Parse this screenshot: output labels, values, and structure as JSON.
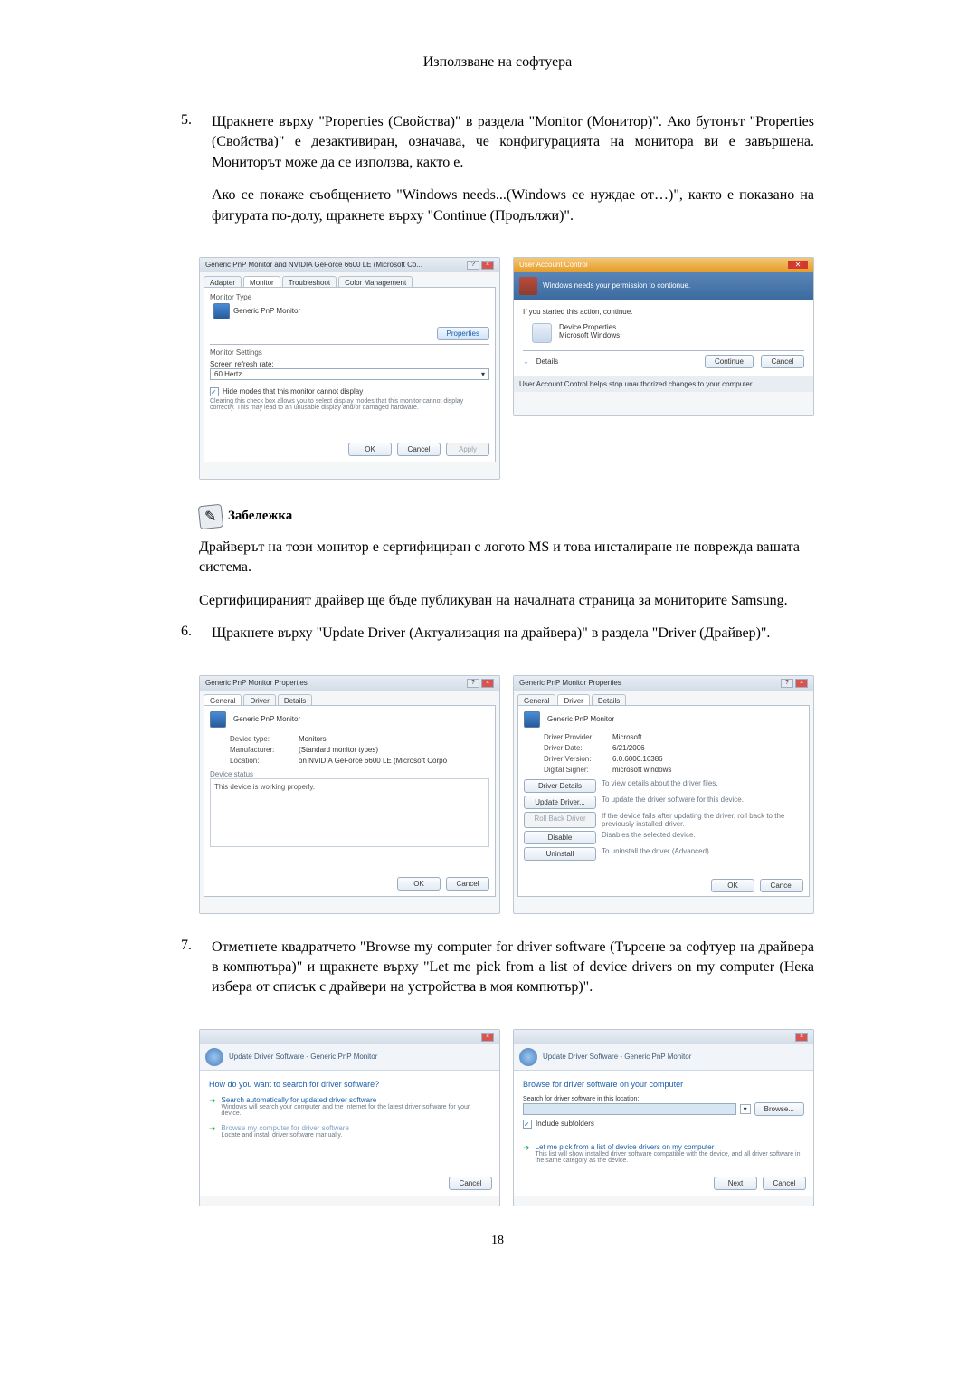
{
  "pageHeader": "Използване на софтуера",
  "step5": {
    "num": "5.",
    "para1": "Щракнете върху \"Properties (Свойства)\" в раздела \"Monitor (Монитор)\". Ако бутонът \"Properties (Свойства)\" е дезактивиран, означава, че конфигурацията на монитора ви е завършена. Мониторът може да се използва, както е.",
    "para2": "Ако се покаже съобщението \"Windows needs...(Windows се нуждае от…)\", както е показано на фигурата по-долу, щракнете върху \"Continue (Продължи)\"."
  },
  "fig1a": {
    "title": "Generic PnP Monitor and NVIDIA GeForce 6600 LE (Microsoft Co...",
    "tabs": {
      "adapter": "Adapter",
      "monitor": "Monitor",
      "troubleshoot": "Troubleshoot",
      "color": "Color Management"
    },
    "monitorType": "Monitor Type",
    "monitorName": "Generic PnP Monitor",
    "propertiesBtn": "Properties",
    "monitorSettings": "Monitor Settings",
    "refreshLabel": "Screen refresh rate:",
    "refreshVal": "60 Hertz",
    "hideModes": "Hide modes that this monitor cannot display",
    "hideHelp": "Clearing this check box allows you to select display modes that this monitor cannot display correctly. This may lead to an unusable display and/or damaged hardware.",
    "ok": "OK",
    "cancel": "Cancel",
    "apply": "Apply"
  },
  "fig1b": {
    "title": "User Account Control",
    "headline": "Windows needs your permission to contionue.",
    "ifStarted": "If you started this action, continue.",
    "devProps": "Device Properties",
    "msWindows": "Microsoft Windows",
    "details": "Details",
    "continue": "Continue",
    "cancel": "Cancel",
    "footer": "User Account Control helps stop unauthorized changes to your computer."
  },
  "noteTitle": "Забележка",
  "note1": "Драйверът на този монитор е сертифициран с логото MS и това инсталиране не поврежда вашата система.",
  "note2": "Сертифицираният драйвер ще бъде публикуван на началната страница за мониторите Samsung.",
  "step6": {
    "num": "6.",
    "text": "Щракнете върху \"Update Driver (Актуализация на драйвера)\" в раздела \"Driver (Драйвер)\"."
  },
  "fig2a": {
    "title": "Generic PnP Monitor Properties",
    "tabs": {
      "general": "General",
      "driver": "Driver",
      "details": "Details"
    },
    "name": "Generic PnP Monitor",
    "deviceType": "Device type:",
    "deviceTypeV": "Monitors",
    "manufacturer": "Manufacturer:",
    "manufacturerV": "(Standard monitor types)",
    "location": "Location:",
    "locationV": "on NVIDIA GeForce 6600 LE (Microsoft Corpo",
    "statusLabel": "Device status",
    "statusText": "This device is working properly.",
    "ok": "OK",
    "cancel": "Cancel"
  },
  "fig2b": {
    "title": "Generic PnP Monitor Properties",
    "tabs": {
      "general": "General",
      "driver": "Driver",
      "details": "Details"
    },
    "name": "Generic PnP Monitor",
    "provider": "Driver Provider:",
    "providerV": "Microsoft",
    "date": "Driver Date:",
    "dateV": "6/21/2006",
    "version": "Driver Version:",
    "versionV": "6.0.6000.16386",
    "signer": "Digital Signer:",
    "signerV": "microsoft windows",
    "driverDetails": "Driver Details",
    "driverDetailsD": "To view details about the driver files.",
    "updateDriver": "Update Driver...",
    "updateDriverD": "To update the driver software for this device.",
    "rollBack": "Roll Back Driver",
    "rollBackD": "If the device fails after updating the driver, roll back to the previously installed driver.",
    "disable": "Disable",
    "disableD": "Disables the selected device.",
    "uninstall": "Uninstall",
    "uninstallD": "To uninstall the driver (Advanced).",
    "ok": "OK",
    "cancel": "Cancel"
  },
  "step7": {
    "num": "7.",
    "text": "Отметнете квадратчето \"Browse my computer for driver software (Търсене за софтуер на драйвера в компютъра)\" и щракнете върху \"Let me pick from a list of device drivers on my computer (Нека избера от списък с драйвери на устройства в моя компютър)\"."
  },
  "fig3a": {
    "path": "Update Driver Software - Generic PnP Monitor",
    "heading": "How do you want to search for driver software?",
    "opt1t": "Search automatically for updated driver software",
    "opt1d": "Windows will search your computer and the Internet for the latest driver software for your device.",
    "opt2t": "Browse my computer for driver software",
    "opt2d": "Locate and install driver software manually.",
    "cancel": "Cancel"
  },
  "fig3b": {
    "path": "Update Driver Software - Generic PnP Monitor",
    "heading": "Browse for driver software on your computer",
    "searchLabel": "Search for driver software in this location:",
    "browse": "Browse...",
    "include": "Include subfolders",
    "opt1t": "Let me pick from a list of device drivers on my computer",
    "opt1d": "This list will show installed driver software compatible with the device, and all driver software in the same category as the device.",
    "next": "Next",
    "cancel": "Cancel"
  },
  "pageNumber": "18"
}
